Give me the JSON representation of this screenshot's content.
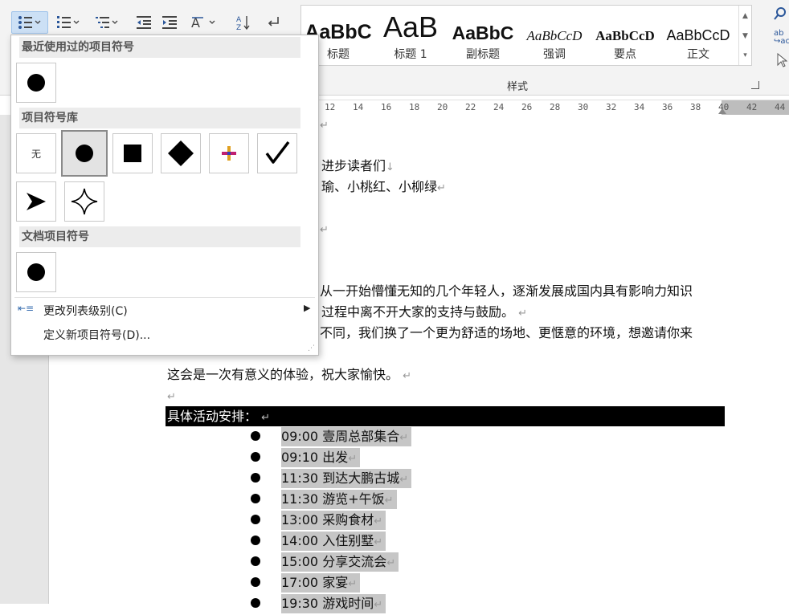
{
  "colors": {
    "accent": "#2b579a",
    "highlight": "#c6c6c6",
    "dark_bar": "#000000"
  },
  "toolbar": {
    "buttons": [
      "bullets-button",
      "numbering-button",
      "multilevel-list-button",
      "decrease-indent-button",
      "increase-indent-button",
      "text-effects-button",
      "sort-button",
      "show-formatting-button"
    ]
  },
  "styles": {
    "items": [
      {
        "sample": "AaBbC",
        "name": "标题"
      },
      {
        "sample": "AaB",
        "name": "标题 1"
      },
      {
        "sample": "AaBbC",
        "name": "副标题"
      },
      {
        "sample": "AaBbCcD",
        "name": "强调"
      },
      {
        "sample": "AaBbCcD",
        "name": "要点"
      },
      {
        "sample": "AaBbCcD",
        "name": "正文"
      }
    ],
    "group_label": "样式"
  },
  "ruler": {
    "labels": [
      "12",
      "14",
      "16",
      "18",
      "20",
      "22",
      "24",
      "26",
      "28",
      "30",
      "32",
      "34",
      "36",
      "38",
      "40",
      "42",
      "44"
    ]
  },
  "dropdown": {
    "recent_header": "最近使用过的项目符号",
    "library_header": "项目符号库",
    "library_none": "无",
    "document_header": "文档项目符号",
    "change_level": "更改列表级别(C)",
    "define_new": "定义新项目符号(D)..."
  },
  "document": {
    "line1": "进步读者们",
    "line2": "瑜、小桃红、小柳绿",
    "line3": "从一开始懵懂无知的几个年轻人，逐渐发展成国内具有影响力知识",
    "line4": "过程中离不开大家的支持与鼓励。",
    "line5": "不同，我们换了一个更为舒适的场地、更惬意的环境，想邀请你来",
    "line6": "这会是一次有意义的体验，祝大家愉快。",
    "schedule_heading": "具体活动安排：",
    "schedule": [
      "09:00 壹周总部集合",
      "09:10 出发",
      "11:30 到达大鹏古城",
      "11:30 游览+午饭",
      "13:00 采购食材",
      "14:00 入住别墅",
      "15:00 分享交流会",
      "17:00 家宴",
      "19:30 游戏时间"
    ]
  }
}
